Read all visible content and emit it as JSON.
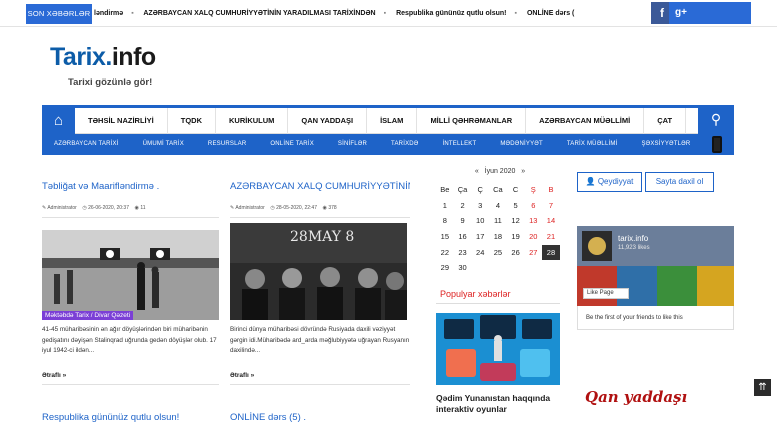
{
  "ticker": {
    "label": "SON XƏBƏRLƏR",
    "items": [
      "ləndirmə",
      "AZƏRBAYCAN XALQ CUMHURİYYƏTİNİN YARADILMASI TARİXİNDƏN",
      "Respublika gününüz qutlu olsun!",
      "ONLİNE dərs ("
    ]
  },
  "social": {
    "facebook_icon": "f",
    "gplus_icon": "g+"
  },
  "logo": {
    "main": "Tarix",
    "dot": ".",
    "suffix": "info",
    "tagline": "Tarixi gözünlə gör!"
  },
  "nav": {
    "home_icon": "⌂",
    "items": [
      "TƏHSİL NAZİRLİYİ",
      "TQDK",
      "KURİKULUM",
      "QAN YADDAŞI",
      "İSLAM",
      "MİLLİ QƏHRƏMANLAR",
      "AZƏRBAYCAN MÜƏLLİMİ",
      "ÇAT"
    ],
    "search_icon": "⚲"
  },
  "subnav": {
    "items": [
      "AZƏRBAYCAN TARİXİ",
      "ÜMUMİ TARİX",
      "RESURSLAR",
      "ONLİNE TARİX",
      "SİNİFLƏR",
      "TARİXDƏ",
      "İNTELLEKT",
      "MƏDƏNİYYƏT",
      "TARİX MÜƏLLİMİ",
      "ŞƏXSİYYƏTLƏR"
    ]
  },
  "posts": [
    {
      "title": "Təbliğat və Maarifləndirmə .",
      "author": "Administrator",
      "date": "26-06-2020, 20:37",
      "views": "11",
      "category": "Məktəbdə Tarix / Divar Qəzeti",
      "excerpt": "41-45 müharibəsinin ən ağır döyüşlərindən biri müharibənin gedişatını dəyişən Stalinqrad uğrunda gedən döyüşlər olub. 17 iyul 1942-ci ildən...",
      "more": "Ətraflı »"
    },
    {
      "title": "AZƏRBAYCAN XALQ CUMHURİYYƏTİNİN .",
      "author": "Administrator",
      "date": "28-05-2020, 22:47",
      "views": "378",
      "image_text": "28MAY 8",
      "excerpt": "Birinci dünya müharibəsi dövründə Rusiyada daxili vəziyyət gərgin idi.Müharibədə ard_arda məğlubiyyətə uğrayan Rusyanın daxilində...",
      "more": "Ətraflı »"
    }
  ],
  "next_posts": [
    "Respublika gününüz qutlu olsun!",
    "ONLİNE dərs (5) ."
  ],
  "calendar": {
    "prev": "«",
    "month": "İyun 2020",
    "next": "»",
    "days": [
      "Be",
      "Ça",
      "Ç",
      "Ca",
      "C",
      "Ş",
      "B"
    ],
    "weeks": [
      [
        "1",
        "2",
        "3",
        "4",
        "5",
        "6",
        "7"
      ],
      [
        "8",
        "9",
        "10",
        "11",
        "12",
        "13",
        "14"
      ],
      [
        "15",
        "16",
        "17",
        "18",
        "19",
        "20",
        "21"
      ],
      [
        "22",
        "23",
        "24",
        "25",
        "26",
        "27",
        "28"
      ],
      [
        "29",
        "30",
        "",
        "",
        "",
        "",
        ""
      ]
    ],
    "today": "28"
  },
  "popular": {
    "title": "Populyar xəbərlər",
    "caption": "Qədim Yunanıstan haqqında interaktiv oyunlar"
  },
  "auth": {
    "register": "Qeydiyyat",
    "login": "Sayta daxil ol"
  },
  "facebook": {
    "page_name": "tarix.info",
    "likes": "11,923 likes",
    "like_button": "Like Page",
    "friends_text": "Be the first of your friends to like this"
  },
  "banner": {
    "text": "Qan yaddaşı"
  },
  "scroll_top_icon": "⇈",
  "colors": {
    "accent": "#1e63c8",
    "red": "#d22222",
    "badge": "#7b3fd6"
  }
}
